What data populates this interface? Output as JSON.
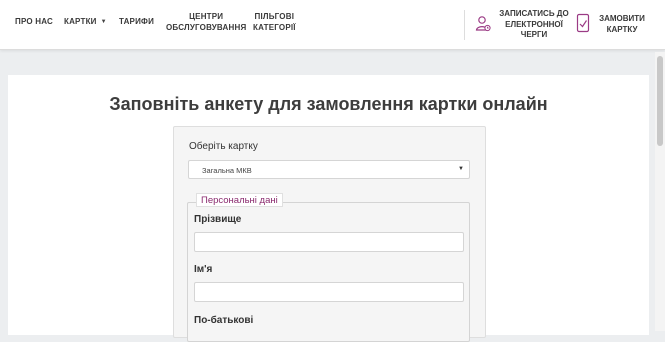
{
  "nav": {
    "about": "ПРО НАС",
    "cards": "КАРТКИ",
    "tariffs": "ТАРИФИ",
    "centers_line1": "ЦЕНТРИ",
    "centers_line2": "ОБСЛУГОВУВАННЯ",
    "benefits_line1": "ПІЛЬГОВІ",
    "benefits_line2": "КАТЕГОРІЇ"
  },
  "actions": {
    "queue_line1": "ЗАПИСАТИСЬ ДО",
    "queue_line2": "ЕЛЕКТРОННОЇ",
    "queue_line3": "ЧЕРГИ",
    "order_line1": "ЗАМОВИТИ",
    "order_line2": "КАРТКУ"
  },
  "form": {
    "title": "Заповніть анкету для замовлення картки онлайн",
    "card_select_label": "Оберіть картку",
    "card_select_value": "Загальна МКВ",
    "personal_legend": "Персональні дані",
    "surname_label": "Прізвище",
    "surname_value": "",
    "name_label": "Ім'я",
    "name_value": "",
    "patronymic_label": "По-батькові"
  },
  "colors": {
    "accent": "#8a2a6e",
    "icon": "#9b3b85"
  }
}
